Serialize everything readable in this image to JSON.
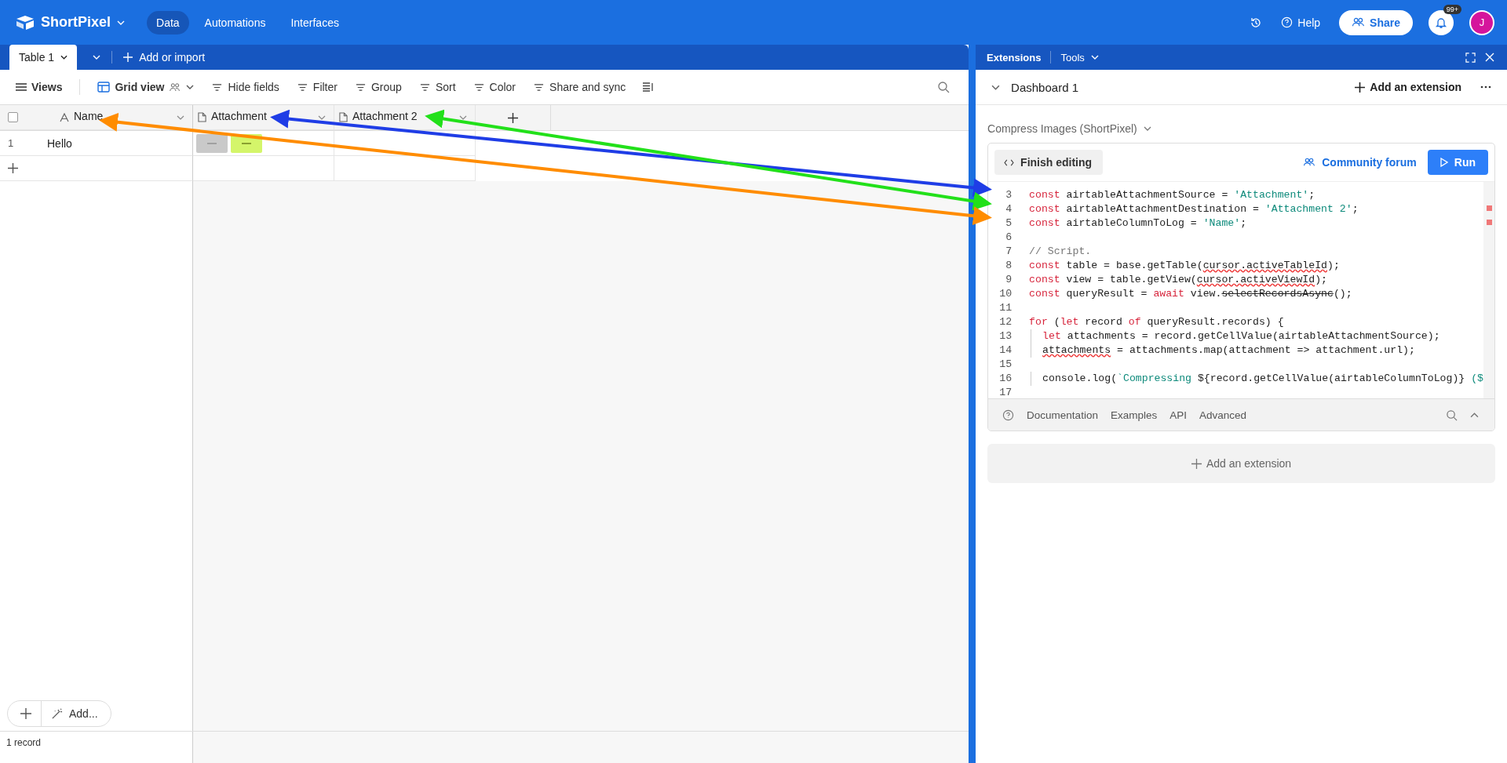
{
  "topbar": {
    "app_name": "ShortPixel",
    "nav": [
      {
        "label": "Data",
        "selected": true
      },
      {
        "label": "Automations",
        "selected": false
      },
      {
        "label": "Interfaces",
        "selected": false
      }
    ],
    "help": "Help",
    "share": "Share",
    "notifications": "99+",
    "avatar": "J"
  },
  "tabs": {
    "items": [
      {
        "label": "Table 1",
        "selected": true
      }
    ],
    "add": "Add or import"
  },
  "toolbar": {
    "views": "Views",
    "view_name": "Grid view",
    "actions": [
      "Hide fields",
      "Filter",
      "Group",
      "Sort",
      "Color",
      "Share and sync"
    ]
  },
  "table": {
    "select_all": {
      "checked": false
    },
    "columns": [
      {
        "label": "Name",
        "kind": "text"
      },
      {
        "label": "Attachment",
        "kind": "file"
      },
      {
        "label": "Attachment 2",
        "kind": "file"
      }
    ],
    "rows": [
      {
        "number": "1",
        "name": "Hello"
      }
    ]
  },
  "footer": {
    "add": "Add...",
    "count": "1 record"
  },
  "extensions": {
    "tabs": [
      "Extensions",
      "Tools"
    ],
    "dashboard": "Dashboard 1",
    "add_extension": "Add an extension",
    "extension_name": "Compress Images (ShortPixel)",
    "finish_editing": "Finish editing",
    "community": "Community forum",
    "run": "Run",
    "code": [
      {
        "n": "3",
        "tokens": [
          {
            "t": "const ",
            "kind": "kw"
          },
          {
            "t": "airtableAttachmentSource = ",
            "kind": "plain"
          },
          {
            "t": "'Attachment'",
            "kind": "str"
          },
          {
            "t": ";",
            "kind": "plain"
          }
        ]
      },
      {
        "n": "4",
        "tokens": [
          {
            "t": "const ",
            "kind": "kw"
          },
          {
            "t": "airtableAttachmentDestination = ",
            "kind": "plain"
          },
          {
            "t": "'Attachment 2'",
            "kind": "str"
          },
          {
            "t": ";",
            "kind": "plain"
          }
        ]
      },
      {
        "n": "5",
        "tokens": [
          {
            "t": "const ",
            "kind": "kw"
          },
          {
            "t": "airtableColumnToLog = ",
            "kind": "plain"
          },
          {
            "t": "'Name'",
            "kind": "str"
          },
          {
            "t": ";",
            "kind": "plain"
          }
        ]
      },
      {
        "n": "6"
      },
      {
        "n": "7",
        "tokens": [
          {
            "t": "// Script.",
            "kind": "comment"
          }
        ]
      },
      {
        "n": "8",
        "tokens": [
          {
            "t": "const ",
            "kind": "kw"
          },
          {
            "t": "table = base.getTable(",
            "kind": "plain"
          },
          {
            "t": "cursor.activeTableId",
            "kind": "squiggle"
          },
          {
            "t": ");",
            "kind": "plain"
          }
        ]
      },
      {
        "n": "9",
        "tokens": [
          {
            "t": "const ",
            "kind": "kw"
          },
          {
            "t": "view = table.getView(",
            "kind": "plain"
          },
          {
            "t": "cursor.activeViewId",
            "kind": "squiggle"
          },
          {
            "t": ");",
            "kind": "plain"
          }
        ]
      },
      {
        "n": "10",
        "tokens": [
          {
            "t": "const ",
            "kind": "kw"
          },
          {
            "t": "queryResult = ",
            "kind": "plain"
          },
          {
            "t": "await ",
            "kind": "kw"
          },
          {
            "t": "view.",
            "kind": "plain"
          },
          {
            "t": "selectRecordsAsync",
            "kind": "strike"
          },
          {
            "t": "();",
            "kind": "plain"
          }
        ]
      },
      {
        "n": "11"
      },
      {
        "n": "12",
        "tokens": [
          {
            "t": "for ",
            "kind": "kw"
          },
          {
            "t": "(",
            "kind": "plain"
          },
          {
            "t": "let ",
            "kind": "kw"
          },
          {
            "t": "record ",
            "kind": "plain"
          },
          {
            "t": "of ",
            "kind": "kw"
          },
          {
            "t": "queryResult.records) {",
            "kind": "plain"
          }
        ]
      },
      {
        "n": "13",
        "indent": true,
        "tokens": [
          {
            "t": "let ",
            "kind": "kw"
          },
          {
            "t": "attachments = record.getCellValue(airtableAttachmentSource);",
            "kind": "plain"
          }
        ]
      },
      {
        "n": "14",
        "indent": true,
        "tokens": [
          {
            "t": "attachments",
            "kind": "squiggle"
          },
          {
            "t": " = attachments.map(attachment => attachment.url);",
            "kind": "plain"
          }
        ]
      },
      {
        "n": "15"
      },
      {
        "n": "16",
        "indent": true,
        "tokens": [
          {
            "t": "console.log(",
            "kind": "plain"
          },
          {
            "t": "`Compressing ",
            "kind": "str"
          },
          {
            "t": "${record.getCellValue(airtableColumnToLog)}",
            "kind": "plain"
          },
          {
            "t": " ($",
            "kind": "str"
          }
        ]
      },
      {
        "n": "17"
      }
    ],
    "footer_links": [
      "Documentation",
      "Examples",
      "API",
      "Advanced"
    ],
    "add_extension_bottom": "Add an extension"
  },
  "annotations": [
    {
      "color": "#1f3de6"
    },
    {
      "color": "#22e01a"
    },
    {
      "color": "#ff8c00"
    }
  ]
}
